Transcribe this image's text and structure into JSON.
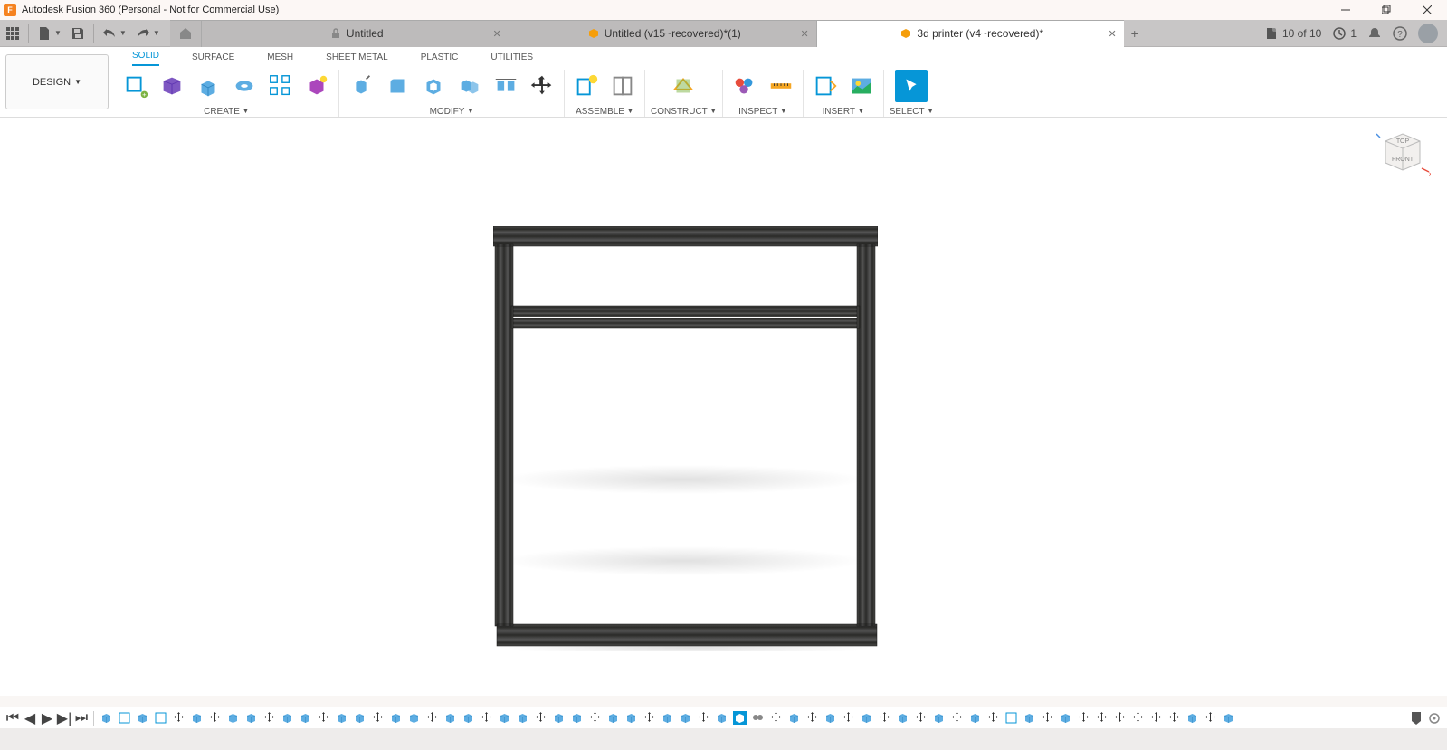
{
  "app": {
    "title": "Autodesk Fusion 360 (Personal - Not for Commercial Use)"
  },
  "tabs": [
    {
      "label": "Untitled",
      "icon": "lock",
      "active": false
    },
    {
      "label": "Untitled (v15~recovered)*(1)",
      "icon": "cube",
      "active": false
    },
    {
      "label": "3d printer (v4~recovered)*",
      "icon": "cube",
      "active": true
    }
  ],
  "header_info": {
    "extensions": "10 of 10",
    "job_status": "1"
  },
  "workspace": {
    "label": "DESIGN"
  },
  "ribbon_tabs": [
    "SOLID",
    "SURFACE",
    "MESH",
    "SHEET METAL",
    "PLASTIC",
    "UTILITIES"
  ],
  "ribbon_active_tab": "SOLID",
  "groups": {
    "create": "CREATE",
    "modify": "MODIFY",
    "assemble": "ASSEMBLE",
    "construct": "CONSTRUCT",
    "inspect": "INSPECT",
    "insert": "INSERT",
    "select": "SELECT"
  },
  "viewcube": {
    "top": "TOP",
    "front": "FRONT"
  }
}
